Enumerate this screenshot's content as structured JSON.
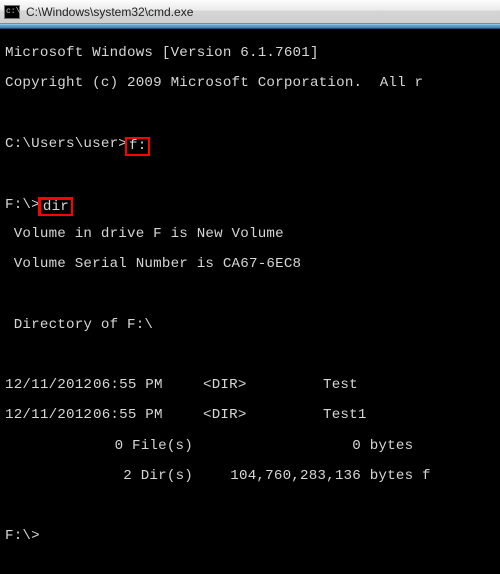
{
  "window": {
    "title": "C:\\Windows\\system32\\cmd.exe",
    "icon_glyph": "c:\\"
  },
  "intro": {
    "line1": "Microsoft Windows [Version 6.1.7601]",
    "line2": "Copyright (c) 2009 Microsoft Corporation.  All r"
  },
  "prompt1": {
    "path": "C:\\Users\\user>",
    "cmd": "f:"
  },
  "prompt2": {
    "path": "F:\\>",
    "cmd": "dir"
  },
  "volume": {
    "line1": " Volume in drive F is New Volume",
    "line2": " Volume Serial Number is CA67-6EC8",
    "dirof": " Directory of F:\\"
  },
  "listing": [
    {
      "date": "12/11/2012",
      "time": "06:55 PM",
      "type": "<DIR>",
      "name": "Test"
    },
    {
      "date": "12/11/2012",
      "time": "06:55 PM",
      "type": "<DIR>",
      "name": "Test1"
    }
  ],
  "summary": {
    "files_a": "0 File(s)",
    "files_b": "0",
    "files_c": " bytes",
    "dirs_a": "2 Dir(s)",
    "dirs_b": "104,760,283,136",
    "dirs_c": " bytes f"
  },
  "prompt3": {
    "path": "F:\\>"
  }
}
